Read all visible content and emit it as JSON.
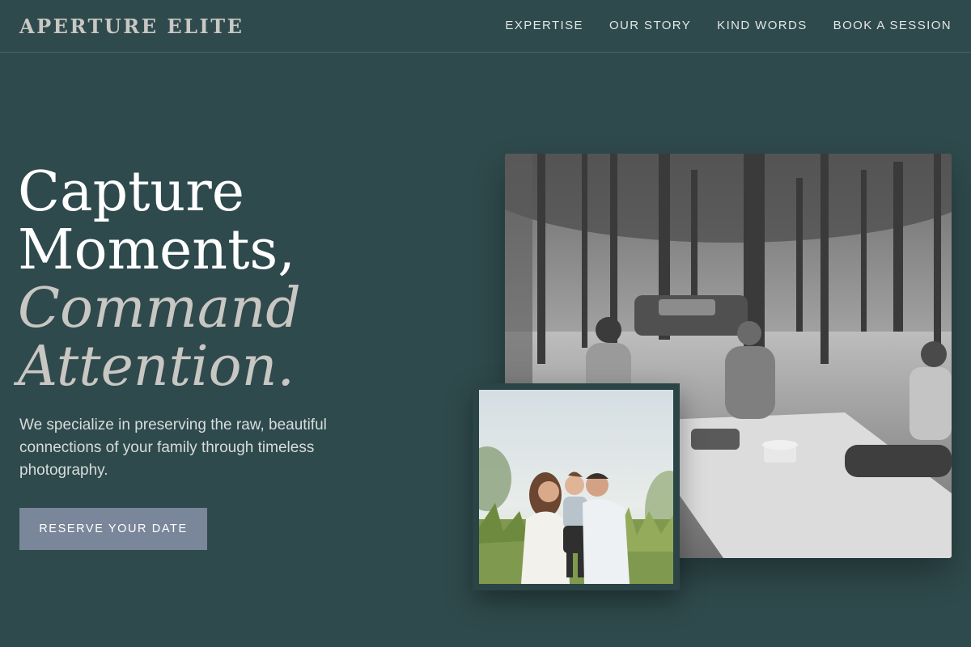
{
  "brand": {
    "logo": "APERTURE ELITE"
  },
  "nav": {
    "items": [
      {
        "label": "EXPERTISE"
      },
      {
        "label": "OUR STORY"
      },
      {
        "label": "KIND WORDS"
      },
      {
        "label": "BOOK A SESSION"
      }
    ]
  },
  "hero": {
    "title_line1": "Capture",
    "title_line2": "Moments,",
    "title_line3": "Command",
    "title_line4": "Attention.",
    "subtitle": "We specialize in preserving the raw, beautiful connections of your family through timeless photography.",
    "cta_label": "RESERVE YOUR DATE"
  },
  "colors": {
    "background": "#2f4a4c",
    "accent_text": "#c9c7c3",
    "button": "#7a8699"
  }
}
